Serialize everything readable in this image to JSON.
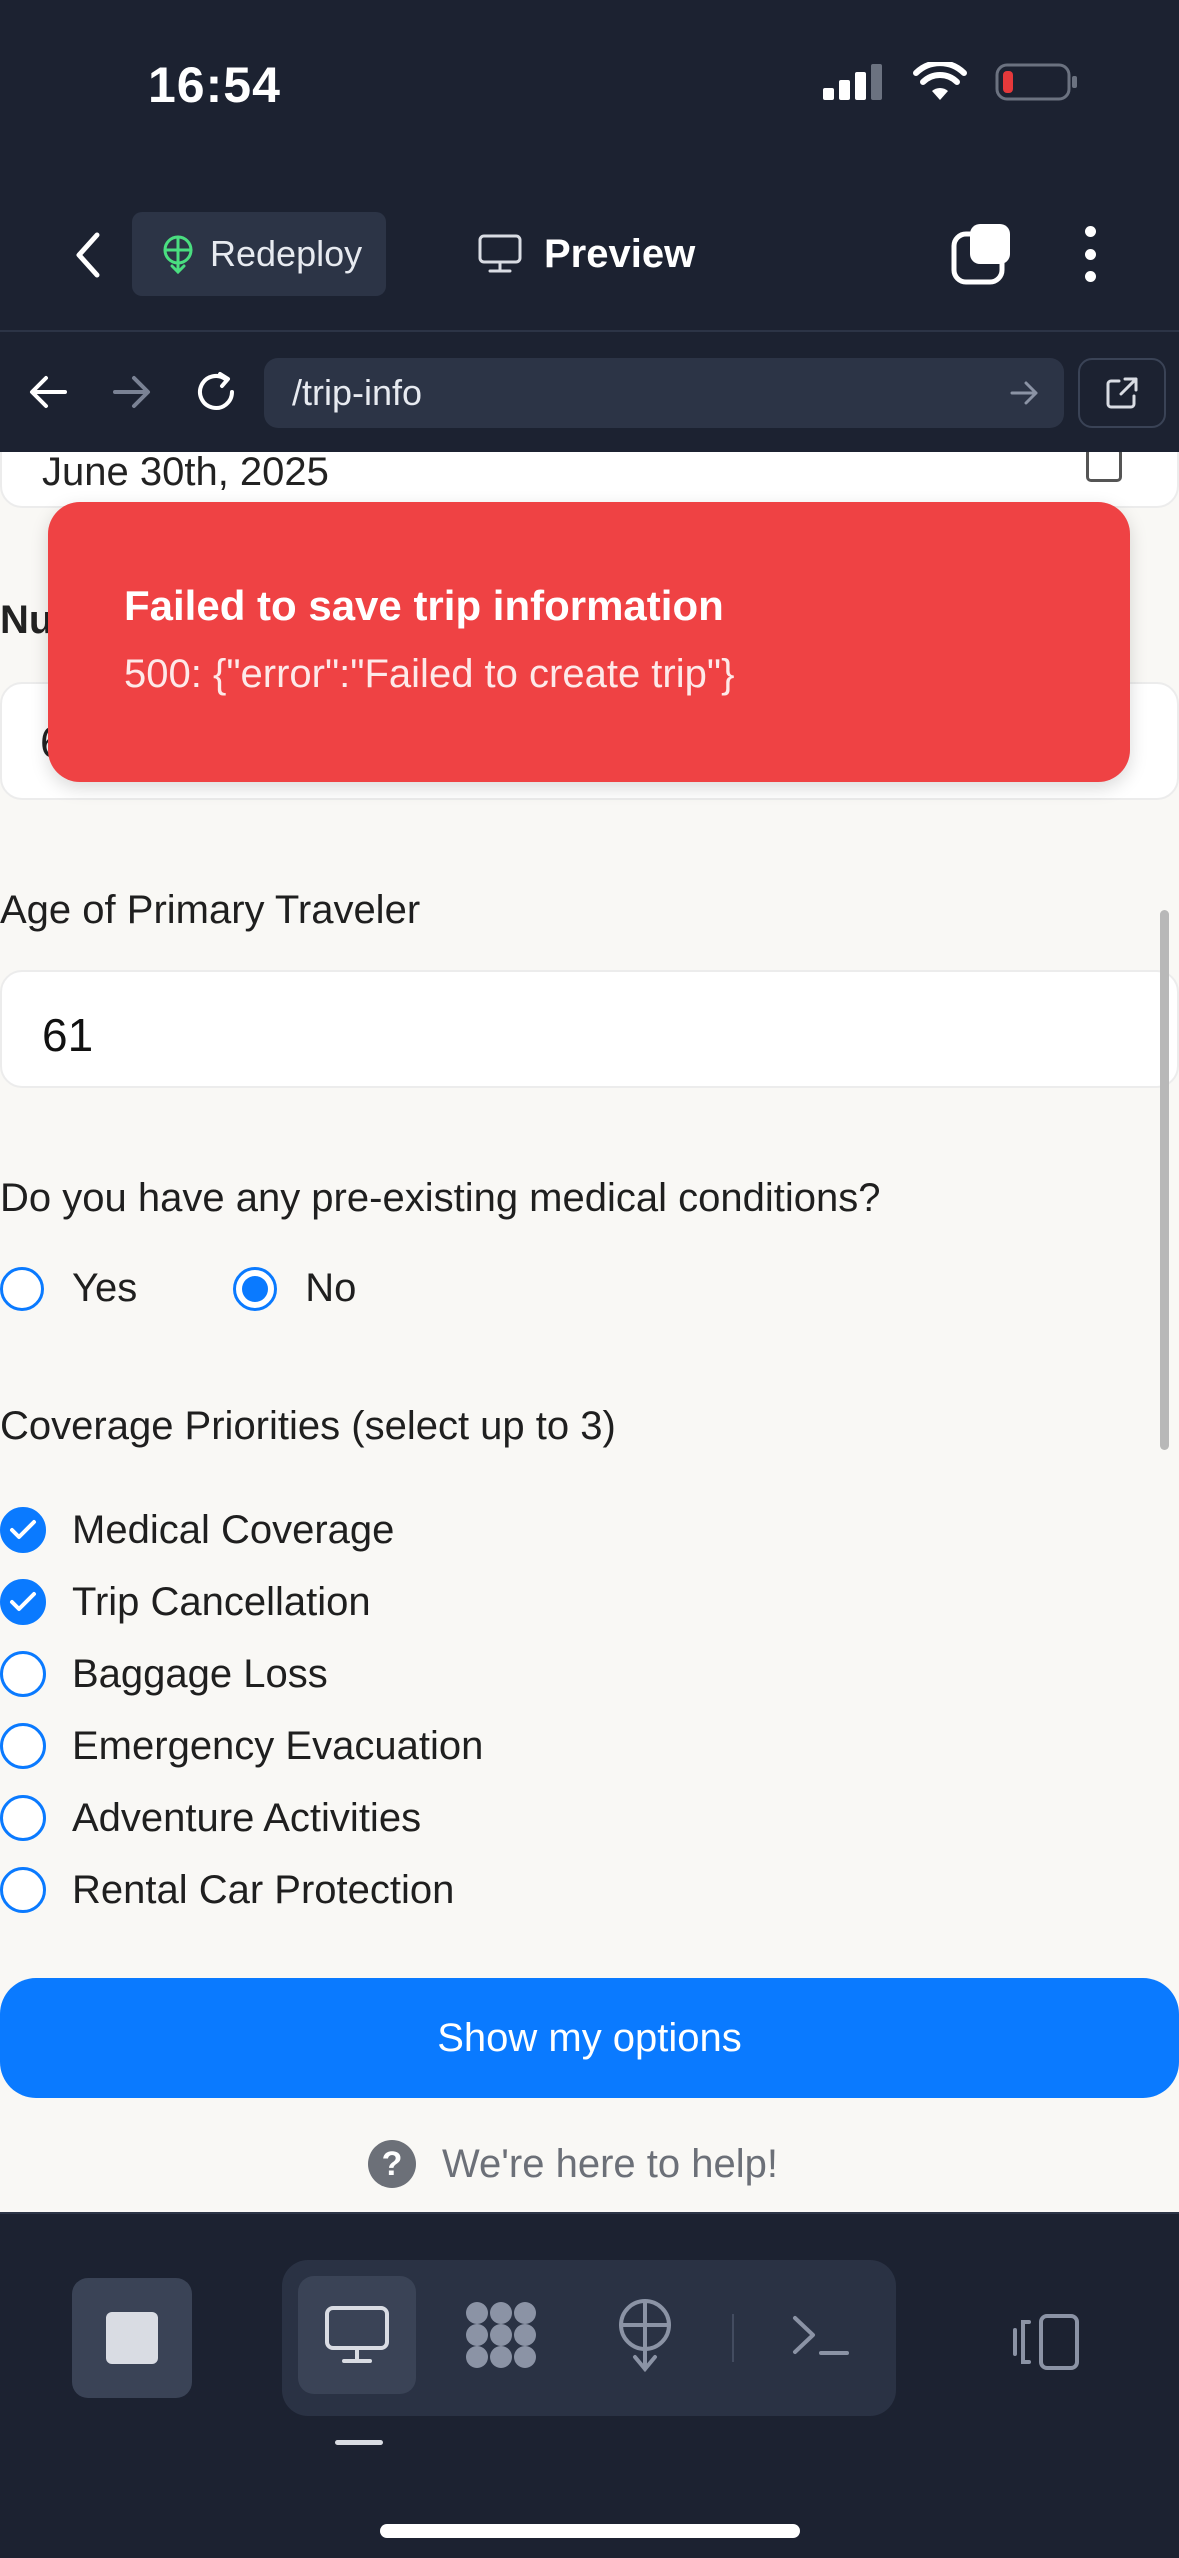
{
  "status_bar": {
    "time": "16:54",
    "battery_color": "#e5393b"
  },
  "header": {
    "back_icon": "chevron-left-icon",
    "redeploy_label": "Redeploy",
    "preview_label": "Preview"
  },
  "url_bar": {
    "url": "/trip-info"
  },
  "form": {
    "date_value": "June 30th, 2025",
    "travelers_label_partial": "Nu",
    "travelers_value_partial": "6",
    "age_label": "Age of Primary Traveler",
    "age_value": "61",
    "medical_question": "Do you have any pre-existing medical conditions?",
    "medical_options": [
      {
        "label": "Yes",
        "selected": false
      },
      {
        "label": "No",
        "selected": true
      }
    ],
    "priorities_label": "Coverage Priorities (select up to 3)",
    "priorities": [
      {
        "label": "Medical Coverage",
        "checked": true
      },
      {
        "label": "Trip Cancellation",
        "checked": true
      },
      {
        "label": "Baggage Loss",
        "checked": false
      },
      {
        "label": "Emergency Evacuation",
        "checked": false
      },
      {
        "label": "Adventure Activities",
        "checked": false
      },
      {
        "label": "Rental Car Protection",
        "checked": false
      }
    ],
    "submit_label": "Show my options",
    "help_text": "We're here to help!",
    "help_icon": "?"
  },
  "toast": {
    "title": "Failed to save trip information",
    "message": "500: {\"error\":\"Failed to create trip\"}",
    "color": "#ef4244"
  },
  "accent_color": "#0a7aff"
}
